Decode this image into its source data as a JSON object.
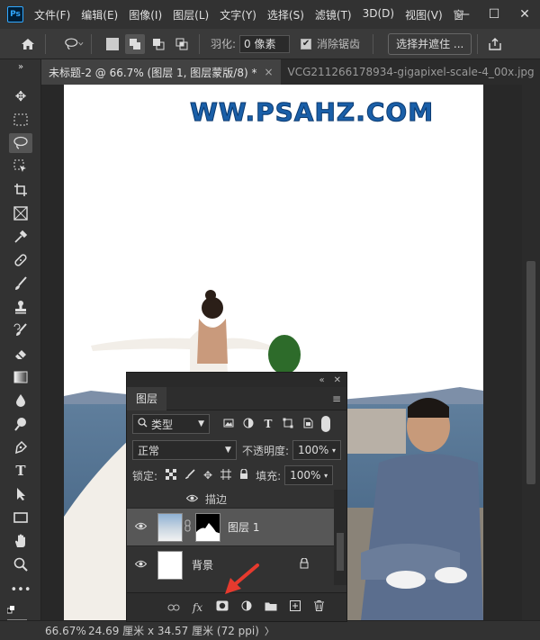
{
  "app": {
    "logo": "Ps"
  },
  "menu": [
    "文件(F)",
    "编辑(E)",
    "图像(I)",
    "图层(L)",
    "文字(Y)",
    "选择(S)",
    "滤镜(T)",
    "3D(D)",
    "视图(V)",
    "窗"
  ],
  "window_controls": {
    "minimize": "—",
    "maximize": "☐",
    "close": "✕"
  },
  "options": {
    "feather_label": "羽化:",
    "feather_value": "0 像素",
    "antialias_label": "消除锯齿",
    "antialias_checked": "✔",
    "select_mask_button": "选择并遮住 ..."
  },
  "tabs": [
    {
      "label": "未标题-2 @ 66.7% (图层 1, 图层蒙版/8) *",
      "close": "×"
    },
    {
      "label": "VCG211266178934-gigapixel-scale-4_00x.jpg",
      "close": "×"
    }
  ],
  "canvas": {
    "watermark": "WW.PSAHZ.COM"
  },
  "status": {
    "zoom": "66.67%",
    "doc_size": "24.69 厘米 x 34.57 厘米 (72 ppi)",
    "expand": "〉"
  },
  "layers_panel": {
    "collapse": "«",
    "close": "✕",
    "title": "图层",
    "menu_icon": "≡",
    "filter_kind": "类型",
    "blend_mode": "正常",
    "opacity_label": "不透明度:",
    "opacity_value": "100%",
    "lock_label": "锁定:",
    "fill_label": "填充:",
    "fill_value": "100%",
    "effect_name": "描边",
    "layers": [
      {
        "name": "图层 1",
        "selected": true
      },
      {
        "name": "背景",
        "locked": true
      }
    ],
    "footer": {
      "fx": "fx"
    }
  },
  "colors": {
    "accent_arrow": "#e63a2e",
    "watermark": "#1a5fa8",
    "selected_layer": "#575757"
  }
}
